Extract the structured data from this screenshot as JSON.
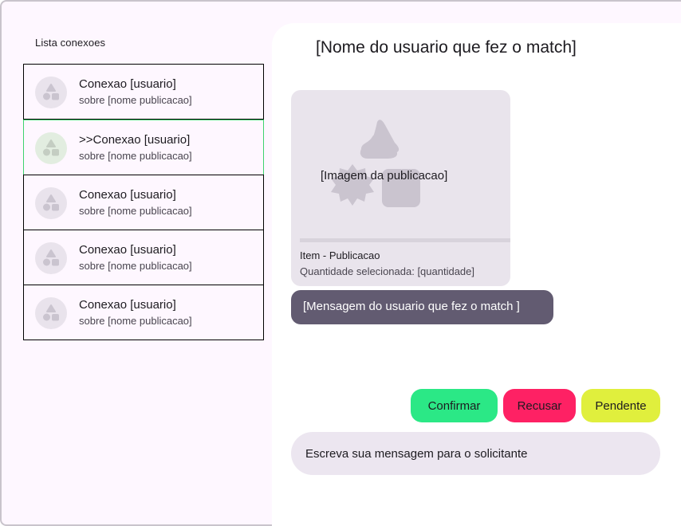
{
  "sidebar": {
    "title": "Lista conexoes",
    "items": [
      {
        "name": "Conexao [usuario]",
        "subtitle": "sobre [nome publicacao]",
        "selected": false
      },
      {
        "name": ">>Conexao [usuario]",
        "subtitle": "sobre [nome publicacao]",
        "selected": true
      },
      {
        "name": "Conexao [usuario]",
        "subtitle": "sobre [nome publicacao]",
        "selected": false
      },
      {
        "name": "Conexao [usuario]",
        "subtitle": "sobre [nome publicacao]",
        "selected": false
      },
      {
        "name": "Conexao [usuario]",
        "subtitle": "sobre [nome publicacao]",
        "selected": false
      }
    ],
    "avatar_icon": "shapes-icon"
  },
  "chat": {
    "title": "[Nome do usuario que fez o match]",
    "publication_card": {
      "image_label": "[Imagem da publicacao]",
      "image_icon": "shapes-placeholder-icon",
      "item_label": "Item - Publicacao",
      "quantity_label": "Quantidade selecionada: [quantidade]"
    },
    "match_message": "[Mensagem do usuario que fez o match ]",
    "actions": {
      "confirm_label": "Confirmar",
      "refuse_label": "Recusar",
      "pending_label": "Pendente"
    },
    "input": {
      "value": "",
      "placeholder": "Escreva sua mensagem para o solicitante"
    }
  },
  "colors": {
    "background": "#fef7ff",
    "selected_border": "#3ed36e",
    "message_bubble": "#625b71",
    "confirm": "#2be886",
    "refuse": "#fe2164",
    "pending": "#e0ef3d"
  }
}
